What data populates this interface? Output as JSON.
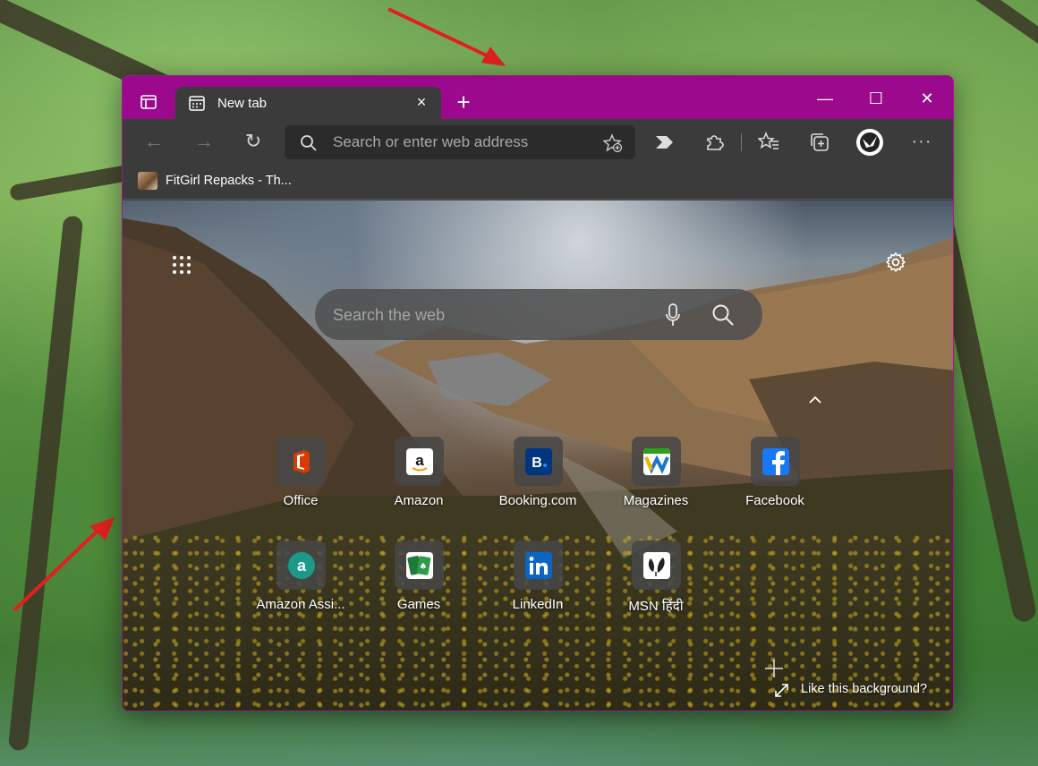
{
  "browser": {
    "tab": {
      "title": "New tab"
    },
    "window_controls": {
      "minimize": "—",
      "maximize": "☐",
      "close": "✕"
    },
    "address_bar": {
      "placeholder": "Search or enter web address",
      "value": ""
    },
    "bookmarks": [
      {
        "label": "FitGirl Repacks - Th..."
      }
    ],
    "theme_color": "#9b0a8c"
  },
  "new_tab_page": {
    "search": {
      "placeholder": "Search the web"
    },
    "quick_links": [
      {
        "label": "Office",
        "icon": "office-icon",
        "color": "#d83b01"
      },
      {
        "label": "Amazon",
        "icon": "amazon-icon",
        "color": "#ffffff"
      },
      {
        "label": "Booking.com",
        "icon": "booking-icon",
        "color": "#003580"
      },
      {
        "label": "Magazines",
        "icon": "magazines-icon",
        "color": "#2ca01c"
      },
      {
        "label": "Facebook",
        "icon": "facebook-icon",
        "color": "#1877f2"
      },
      {
        "label": "Amazon Assi...",
        "icon": "amazon-assistant-icon",
        "color": "#1b9a8a"
      },
      {
        "label": "Games",
        "icon": "games-icon",
        "color": "#1f7a3a"
      },
      {
        "label": "LinkedIn",
        "icon": "linkedin-icon",
        "color": "#0a66c2"
      },
      {
        "label": "MSN हिंदी",
        "icon": "msn-icon",
        "color": "#ffffff"
      }
    ],
    "background_prompt": "Like this background?"
  }
}
